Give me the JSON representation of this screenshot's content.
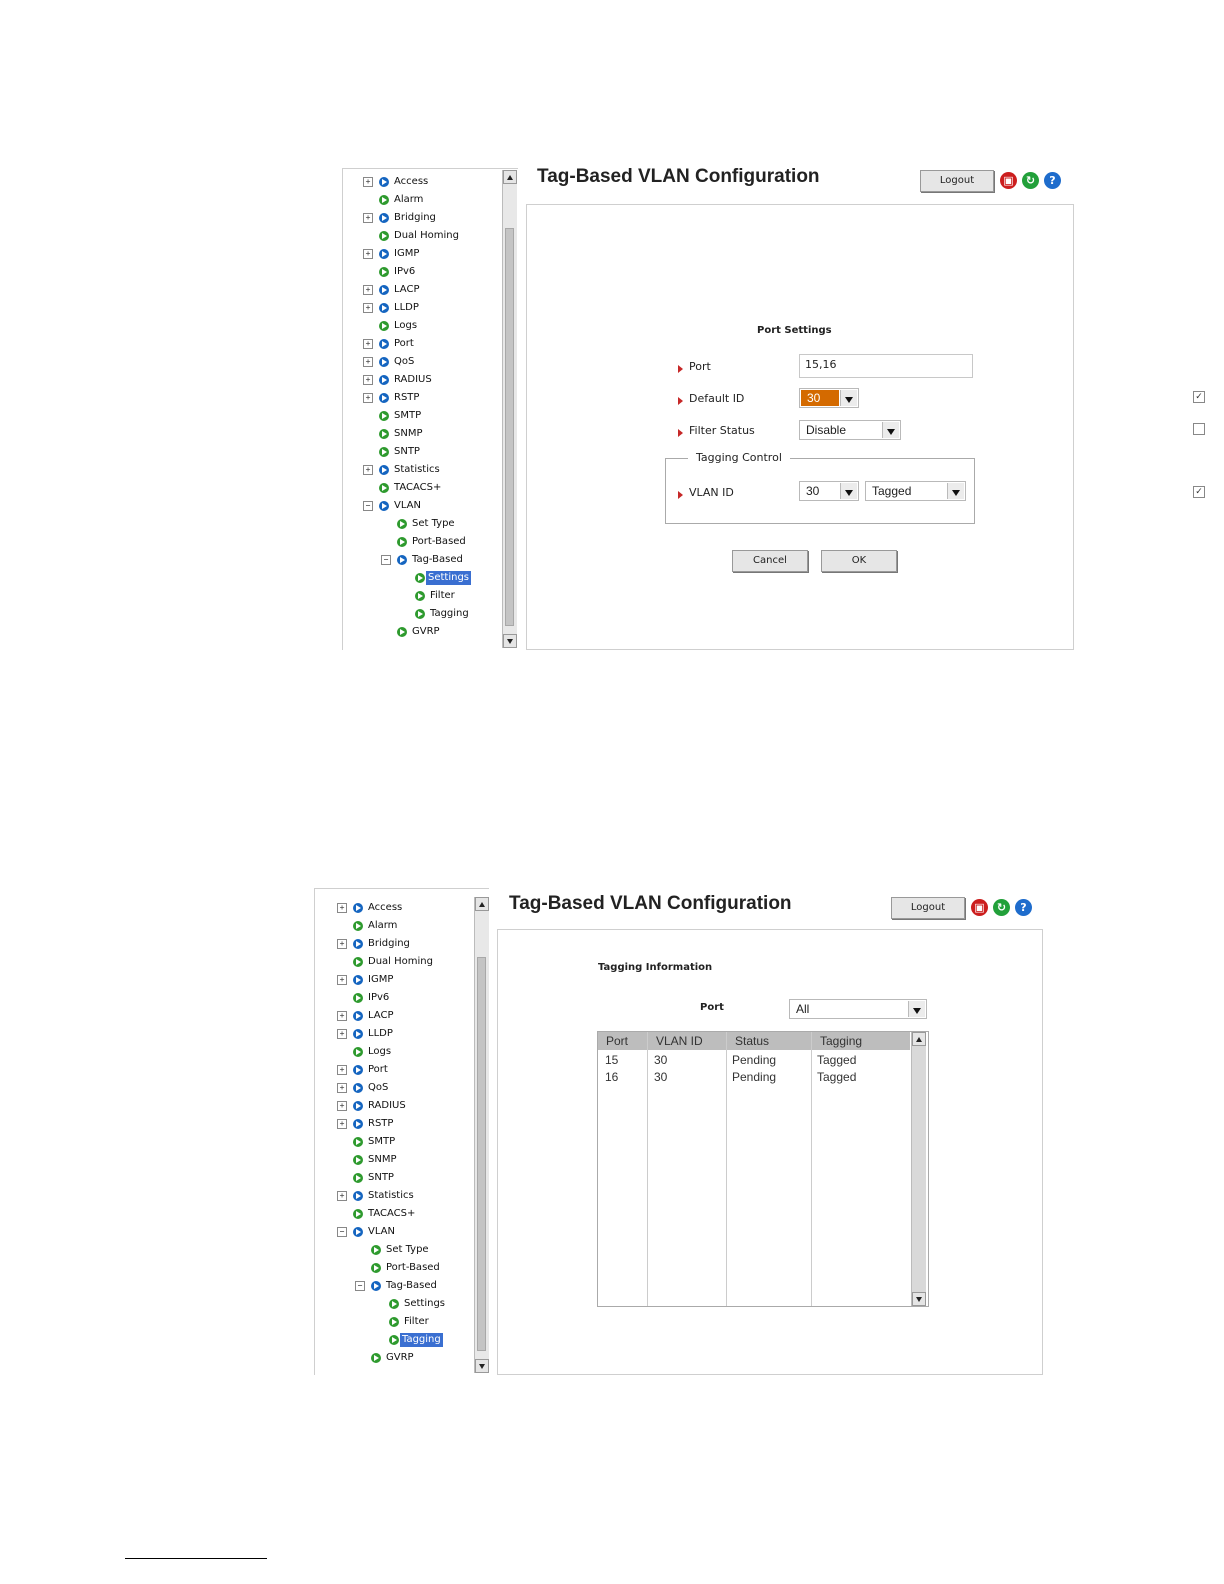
{
  "nav": {
    "items": [
      {
        "label": "Access"
      },
      {
        "label": "Alarm"
      },
      {
        "label": "Bridging"
      },
      {
        "label": "Dual Homing"
      },
      {
        "label": "IGMP"
      },
      {
        "label": "IPv6"
      },
      {
        "label": "LACP"
      },
      {
        "label": "LLDP"
      },
      {
        "label": "Logs"
      },
      {
        "label": "Port"
      },
      {
        "label": "QoS"
      },
      {
        "label": "RADIUS"
      },
      {
        "label": "RSTP"
      },
      {
        "label": "SMTP"
      },
      {
        "label": "SNMP"
      },
      {
        "label": "SNTP"
      },
      {
        "label": "Statistics"
      },
      {
        "label": "TACACS+"
      },
      {
        "label": "VLAN"
      },
      {
        "label": "Set Type"
      },
      {
        "label": "Port-Based"
      },
      {
        "label": "Tag-Based"
      },
      {
        "label": "Settings"
      },
      {
        "label": "Filter"
      },
      {
        "label": "Tagging"
      },
      {
        "label": "GVRP"
      }
    ]
  },
  "header": {
    "title": "Tag-Based VLAN Configuration",
    "logout_label": "Logout",
    "icons": [
      "save-icon",
      "refresh-icon",
      "help-icon"
    ]
  },
  "screen1": {
    "selected_item": "Settings",
    "section_title": "Port Settings",
    "port_label": "Port",
    "port_value": "15,16",
    "default_id_label": "Default ID",
    "default_id_value": "30",
    "filter_status_label": "Filter Status",
    "filter_status_value": "Disable",
    "tagging_control_legend": "Tagging Control",
    "vlan_id_label": "VLAN ID",
    "vlan_id_value": "30",
    "tagging_value": "Tagged",
    "cancel_label": "Cancel",
    "ok_label": "OK",
    "checkboxes": {
      "default_id": true,
      "filter_status": false,
      "vlan_id": true
    }
  },
  "screen2": {
    "selected_item": "Tagging",
    "section_title": "Tagging Information",
    "port_label": "Port",
    "port_filter_value": "All",
    "table": {
      "headers": [
        "Port",
        "VLAN ID",
        "Status",
        "Tagging"
      ],
      "rows": [
        [
          "15",
          "30",
          "Pending",
          "Tagged"
        ],
        [
          "16",
          "30",
          "Pending",
          "Tagged"
        ]
      ]
    }
  },
  "colors": {
    "accent_select": "#d46a00",
    "selected_nav": "#3a6fd1",
    "arrow": "#c62828"
  }
}
